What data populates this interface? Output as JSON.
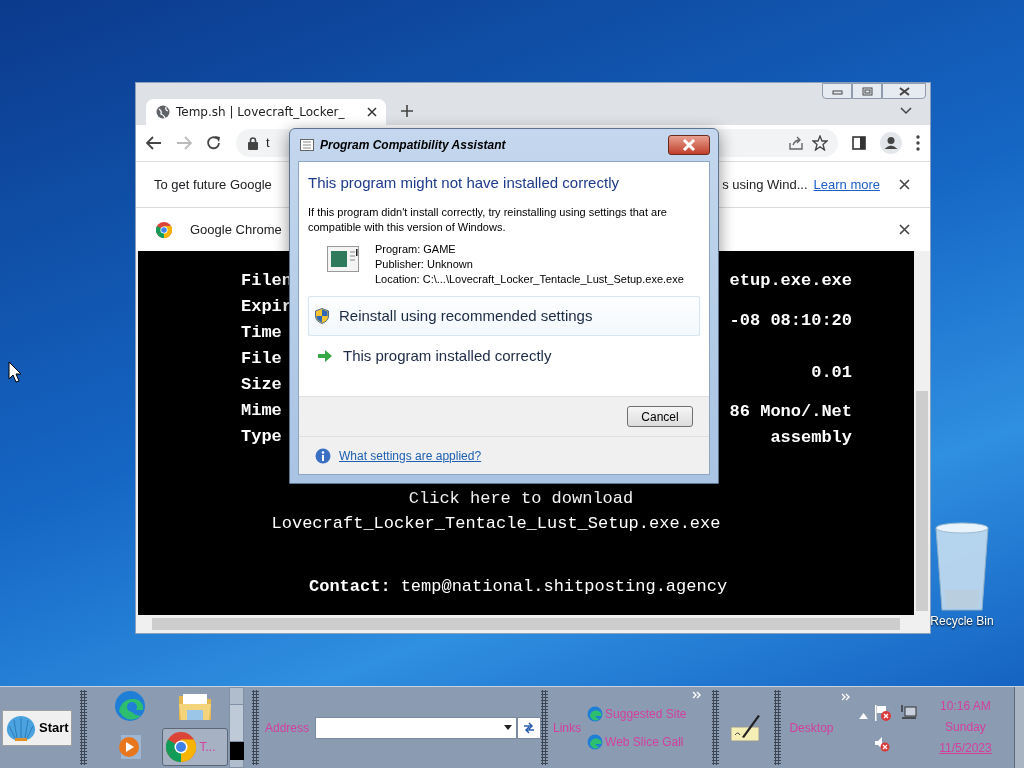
{
  "desktop": {
    "icons": [
      {
        "label": "Recycle Bin"
      }
    ]
  },
  "browser": {
    "tabs": [
      {
        "title": "Temp.sh | Lovecraft_Locker_",
        "selected": true
      }
    ],
    "address": "t",
    "infobars": [
      {
        "kind": "message",
        "text": "To get future Google",
        "text_end": "s using Wind...",
        "link": "Learn more"
      },
      {
        "kind": "app",
        "text": "Google Chrome"
      }
    ],
    "page": {
      "labels": [
        "Filen",
        "Expir",
        "Time",
        "File",
        "Size",
        "Mime",
        "Type"
      ],
      "values": [
        "etup.exe.exe",
        "-08 08:10:20",
        "0.01",
        "86 Mono/.Net",
        "assembly"
      ],
      "download": [
        "Click here to download",
        "Lovecraft_Locker_Tentacle_Lust_Setup.exe.exe"
      ],
      "contact_label": "Contact:",
      "contact": "temp@national.shitposting.agency"
    }
  },
  "dialog": {
    "title": "Program Compatibility Assistant",
    "heading": "This program might not have installed correctly",
    "message": "If this program didn't install correctly, try reinstalling using settings that are compatible with this version of Windows.",
    "details": [
      "Program: GAME",
      "Publisher: Unknown",
      "Location: C:\\...\\Lovecraft_Locker_Tentacle_Lust_Setup.exe.exe"
    ],
    "options": [
      {
        "kind": "shield",
        "label": "Reinstall using recommended settings",
        "selected": true
      },
      {
        "kind": "arrow",
        "label": "This program installed correctly",
        "selected": false
      }
    ],
    "buttons": [
      "Cancel"
    ],
    "link": "What settings are applied?"
  },
  "taskbar": {
    "start": "Start",
    "task": "T...",
    "address_label": "Address",
    "links_label": "Links",
    "links": [
      "Suggested Site",
      "Web Slice Gall"
    ],
    "desktop_label": "Desktop",
    "clock": [
      "10:16 AM",
      "Sunday",
      "11/5/2023"
    ]
  }
}
